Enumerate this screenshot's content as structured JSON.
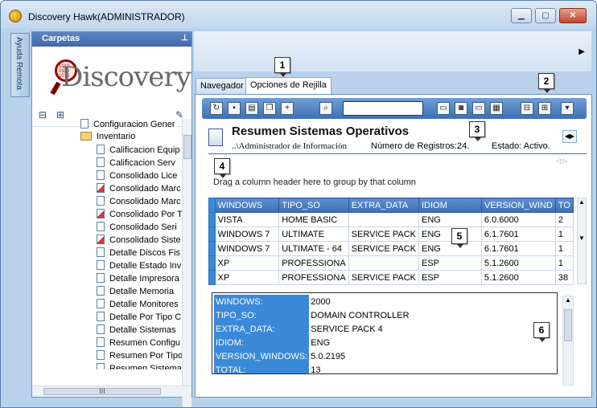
{
  "window": {
    "title": "Discovery Hawk(ADMINISTRADOR)"
  },
  "side_tab": {
    "label": "Ayuda Remota"
  },
  "folders_panel": {
    "title": "Carpetas",
    "logo_text": "Discovery",
    "tree_items": [
      {
        "label": "Configuracion Gener",
        "icon": "doc"
      },
      {
        "label": "Inventario",
        "icon": "folder"
      },
      {
        "label": "Calificacion Equip",
        "icon": "doc"
      },
      {
        "label": "Calificacion Serv",
        "icon": "doc"
      },
      {
        "label": "Consolidado Lice",
        "icon": "doc"
      },
      {
        "label": "Consolidado Marc",
        "icon": "doc-red"
      },
      {
        "label": "Consolidado Marc",
        "icon": "doc"
      },
      {
        "label": "Consolidado Por T",
        "icon": "doc-red"
      },
      {
        "label": "Consolidado Seri",
        "icon": "doc"
      },
      {
        "label": "Consolidado Siste",
        "icon": "doc-red"
      },
      {
        "label": "Detalle Discos Fis",
        "icon": "doc"
      },
      {
        "label": "Detalle Estado Inv",
        "icon": "doc"
      },
      {
        "label": "Detalle Impresora",
        "icon": "doc"
      },
      {
        "label": "Detalle Memoria",
        "icon": "doc"
      },
      {
        "label": "Detalle Monitores",
        "icon": "doc"
      },
      {
        "label": "Detalle Por Tipo C",
        "icon": "doc"
      },
      {
        "label": "Detalle Sistemas",
        "icon": "doc"
      },
      {
        "label": "Resumen Configu",
        "icon": "doc"
      },
      {
        "label": "Resumen Por Tipo",
        "icon": "doc"
      },
      {
        "label": "Resumen Sistema",
        "icon": "doc"
      },
      {
        "label": "Red",
        "icon": "folder"
      }
    ],
    "hscroll_label": "III"
  },
  "tabs": [
    "Navegador",
    "Opciones de Rejilla"
  ],
  "report": {
    "title": "Resumen Sistemas Operativos",
    "path": "..\\Administrador de Información",
    "count": "Número de Registros:24.",
    "state": "Estado: Activo."
  },
  "grid": {
    "group_hint": "Drag a column header here to group by that column",
    "columns": [
      "WINDOWS",
      "TIPO_SO",
      "EXTRA_DATA",
      "IDIOM",
      "VERSION_WIND",
      "TO"
    ],
    "rows": [
      [
        "VISTA",
        "HOME BASIC",
        "",
        "ENG",
        "6.0.6000",
        "2"
      ],
      [
        "WINDOWS 7",
        "ULTIMATE",
        "SERVICE PACK",
        "ENG",
        "6.1.7601",
        "1"
      ],
      [
        "WINDOWS 7",
        "ULTIMATE - 64",
        "SERVICE PACK",
        "ENG",
        "6.1.7601",
        "1"
      ],
      [
        "XP",
        "PROFESSIONA",
        "",
        "ESP",
        "5.1.2600",
        "1"
      ],
      [
        "XP",
        "PROFESSIONA",
        "SERVICE PACK",
        "ESP",
        "5.1.2600",
        "38"
      ]
    ]
  },
  "detail": [
    {
      "k": "WINDOWS:",
      "v": "2000"
    },
    {
      "k": "TIPO_SO:",
      "v": "DOMAIN CONTROLLER"
    },
    {
      "k": "EXTRA_DATA:",
      "v": "SERVICE PACK 4"
    },
    {
      "k": "IDIOM:",
      "v": "ENG"
    },
    {
      "k": "VERSION_WINDOWS:",
      "v": "5.0.2195"
    },
    {
      "k": "TOTAL:",
      "v": "13"
    }
  ],
  "callouts": [
    "1",
    "2",
    "3",
    "4",
    "5",
    "6"
  ],
  "colors": {
    "accent": "#3c70b4",
    "row_indicator": "#3a89d9"
  }
}
